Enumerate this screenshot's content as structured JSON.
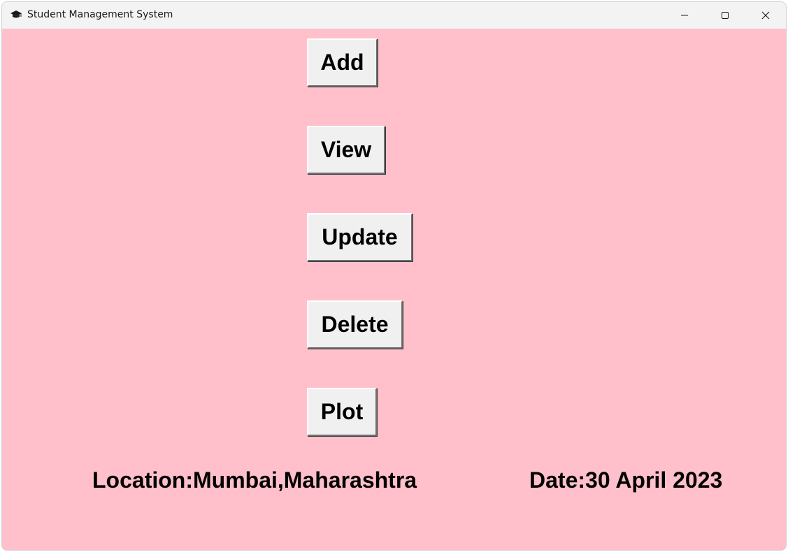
{
  "window": {
    "title": "Student Management System",
    "icon": "graduation-cap-icon",
    "controls": [
      "minimize-icon",
      "maximize-icon",
      "close-icon"
    ]
  },
  "colors": {
    "background": "#ffc0cb",
    "button_face": "#f0f0f0"
  },
  "buttons": {
    "add": "Add",
    "view": "View",
    "update": "Update",
    "delete": "Delete",
    "plot": "Plot"
  },
  "footer": {
    "location": "Location:Mumbai,Maharashtra",
    "date": "Date:30 April 2023"
  }
}
